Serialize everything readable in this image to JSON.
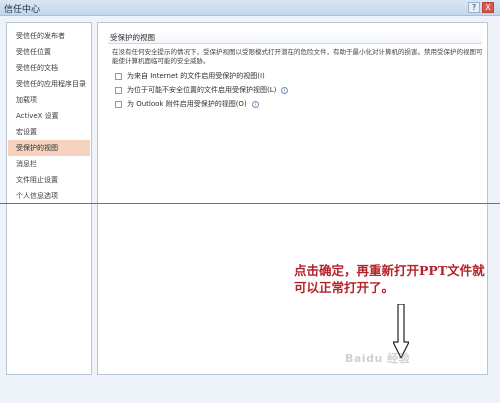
{
  "window": {
    "title": "信任中心",
    "controls": {
      "help": "?",
      "close": "X"
    }
  },
  "sidebar": {
    "items": [
      {
        "label": "受信任的发布者",
        "selected": false
      },
      {
        "label": "受信任位置",
        "selected": false
      },
      {
        "label": "受信任的文档",
        "selected": false
      },
      {
        "label": "受信任的应用程序目录",
        "selected": false
      },
      {
        "label": "加载项",
        "selected": false
      },
      {
        "label": "ActiveX 设置",
        "selected": false
      },
      {
        "label": "宏设置",
        "selected": false
      },
      {
        "label": "受保护的视图",
        "selected": true
      },
      {
        "label": "消息栏",
        "selected": false
      },
      {
        "label": "文件阻止设置",
        "selected": false
      },
      {
        "label": "个人信息选项",
        "selected": false
      }
    ]
  },
  "main": {
    "section_title": "受保护的视图",
    "description": "在没有任何安全提示的情况下，受保护视图以受限模式打开潜在的危险文件，有助于最小化对计算机的损害。禁用受保护的视图可能使计算机面临可能的安全威胁。",
    "options": [
      {
        "label": "为来自 Internet 的文件启用受保护的视图(I)",
        "checked": false,
        "info": false
      },
      {
        "label": "为位于可能不安全位置的文件启用受保护视图(L)",
        "checked": false,
        "info": true
      },
      {
        "label": "为 Outlook 附件启用受保护的视图(O)",
        "checked": false,
        "info": true
      }
    ]
  },
  "annotation": {
    "text": "点击确定，再重新打开PPT文件就可以正常打开了。"
  },
  "watermark": "Baidu 经验",
  "colors": {
    "selected_bg": "#f6d3be",
    "annotation": "#b4232a",
    "guide_line": "#e3403f"
  }
}
